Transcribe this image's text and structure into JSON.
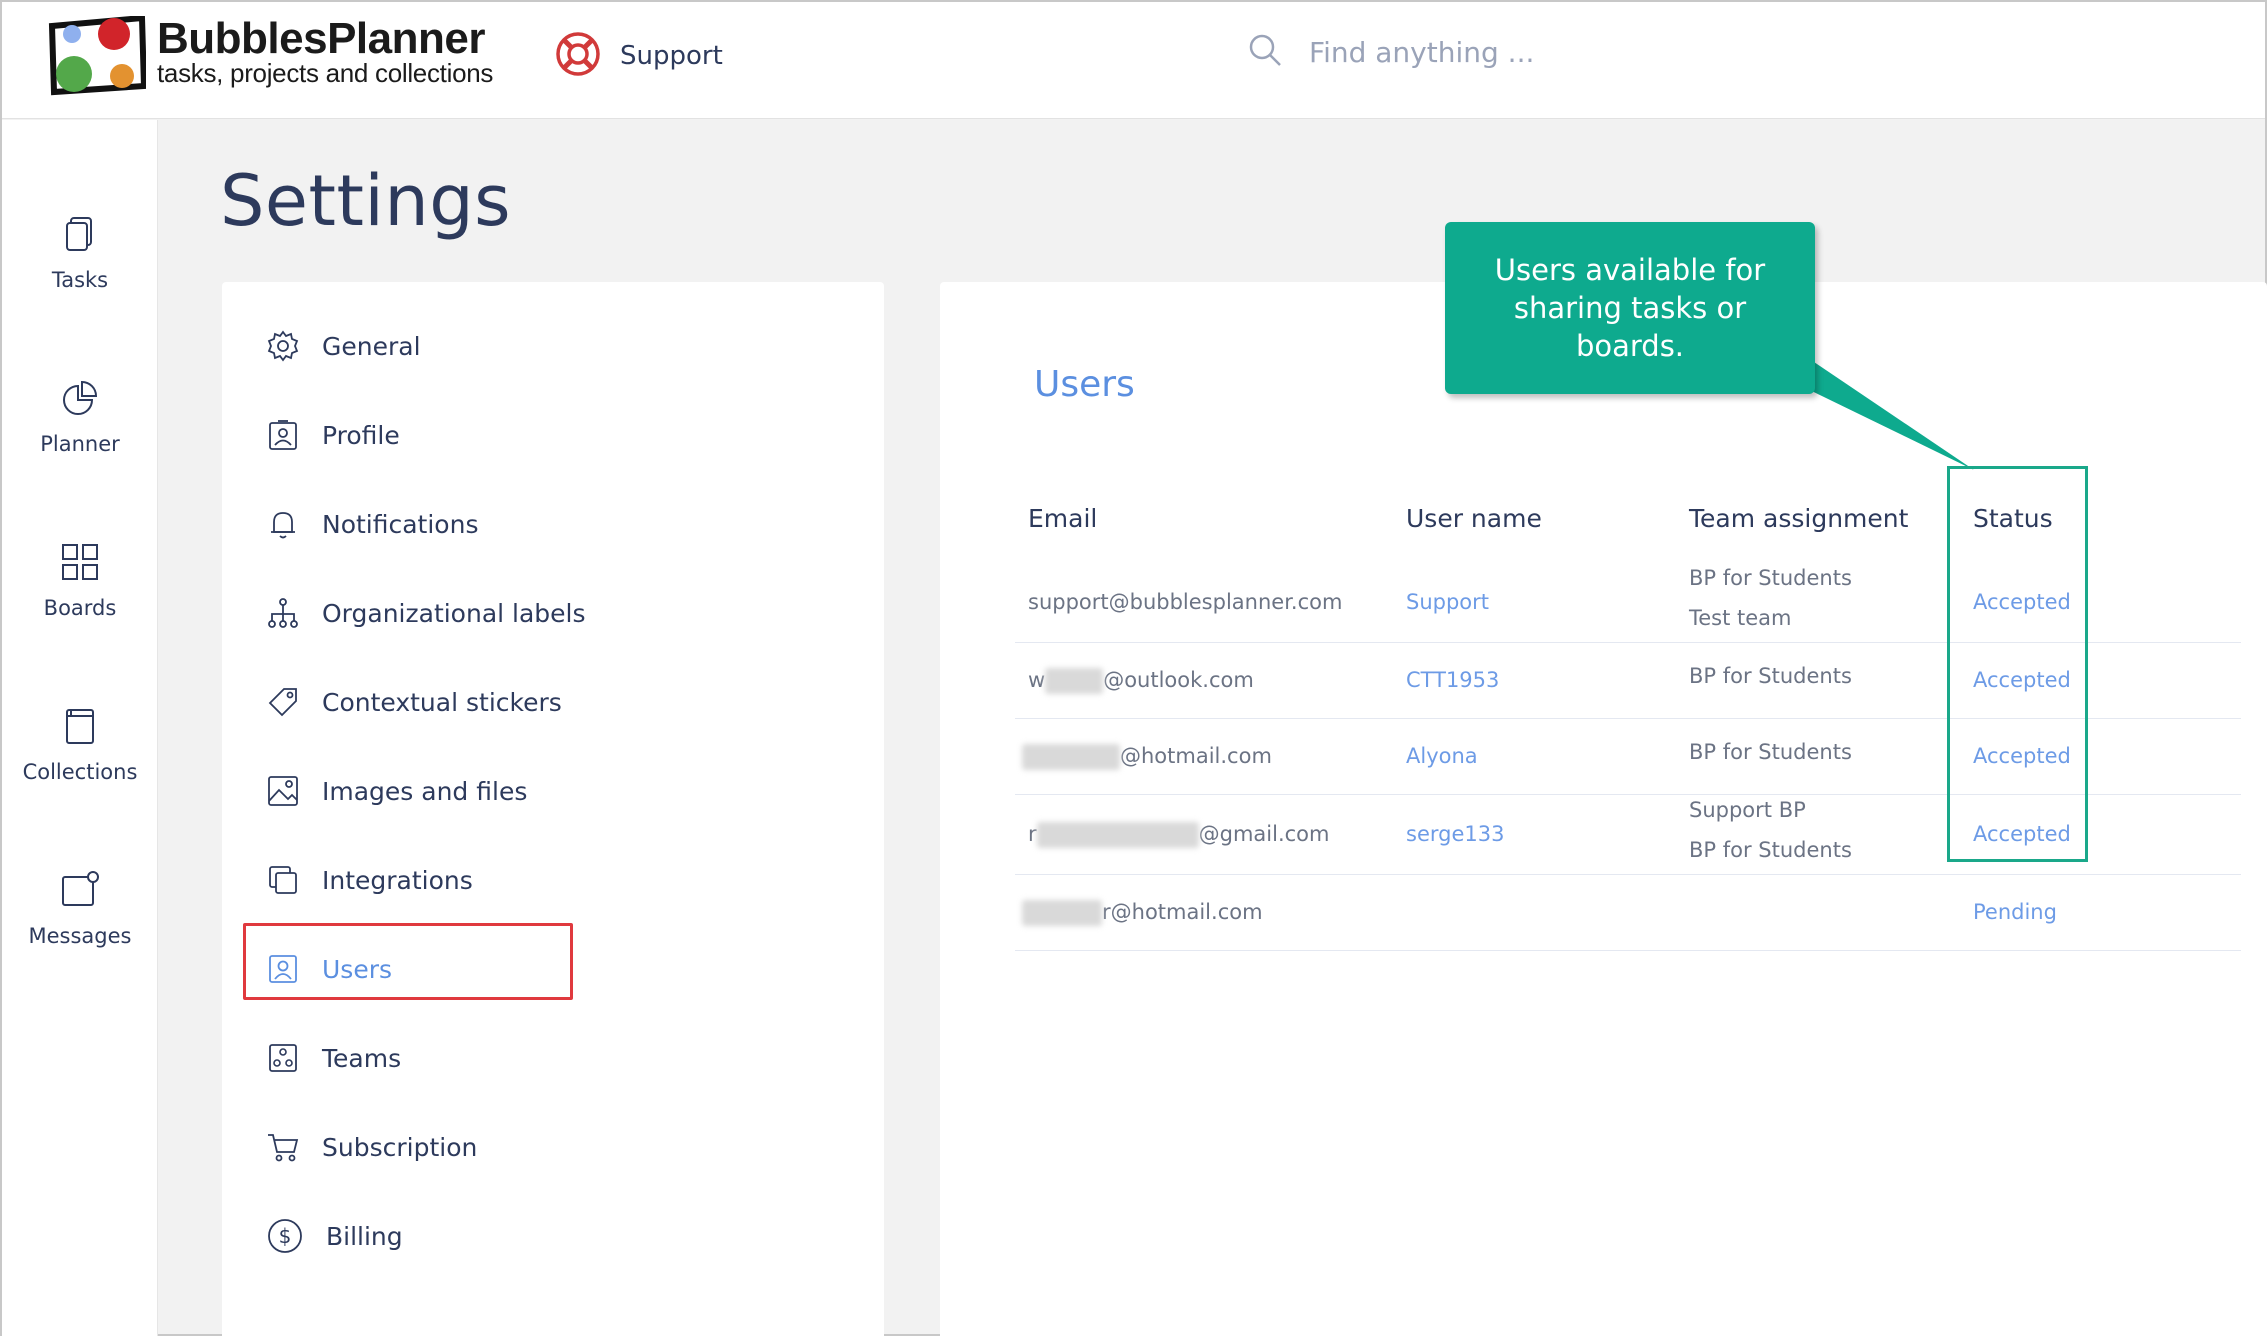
{
  "brand": {
    "name": "BubblesPlanner",
    "tagline": "tasks, projects and collections"
  },
  "header": {
    "support_label": "Support",
    "search_placeholder": "Find anything ..."
  },
  "leftnav": {
    "items": [
      {
        "label": "Tasks",
        "icon": "tasks-icon"
      },
      {
        "label": "Planner",
        "icon": "planner-icon"
      },
      {
        "label": "Boards",
        "icon": "boards-icon"
      },
      {
        "label": "Collections",
        "icon": "collections-icon"
      },
      {
        "label": "Messages",
        "icon": "messages-icon"
      }
    ]
  },
  "page": {
    "title": "Settings"
  },
  "settings_menu": {
    "items": [
      {
        "label": "General",
        "icon": "gear-icon"
      },
      {
        "label": "Profile",
        "icon": "profile-icon"
      },
      {
        "label": "Notifications",
        "icon": "bell-icon"
      },
      {
        "label": "Organizational labels",
        "icon": "hierarchy-icon"
      },
      {
        "label": "Contextual stickers",
        "icon": "tag-icon"
      },
      {
        "label": "Images and files",
        "icon": "image-icon"
      },
      {
        "label": "Integrations",
        "icon": "integrations-icon"
      },
      {
        "label": "Users",
        "icon": "user-icon",
        "active": true
      },
      {
        "label": "Teams",
        "icon": "teams-icon"
      },
      {
        "label": "Subscription",
        "icon": "cart-icon"
      },
      {
        "label": "Billing",
        "icon": "dollar-icon"
      }
    ]
  },
  "users": {
    "title": "Users",
    "columns": [
      "Email",
      "User name",
      "Team assignment",
      "Status"
    ],
    "rows": [
      {
        "email": "support@bubblesplanner.com",
        "username": "Support",
        "teams": [
          "BP for Students",
          "Test team"
        ],
        "status": "Accepted"
      },
      {
        "email_prefix": "w",
        "email": "@outlook.com",
        "username": "CTT1953",
        "teams": [
          "BP for Students"
        ],
        "status": "Accepted"
      },
      {
        "email": "@hotmail.com",
        "username": "Alyona",
        "teams": [
          "BP for Students"
        ],
        "status": "Accepted"
      },
      {
        "email_prefix": "r",
        "email": "@gmail.com",
        "username": "serge133",
        "teams": [
          "Support BP",
          "BP for Students"
        ],
        "status": "Accepted"
      },
      {
        "email": "r@hotmail.com",
        "username": "",
        "teams": [],
        "status": "Pending"
      }
    ]
  },
  "callout": {
    "text": "Users available for sharing tasks or boards."
  },
  "colors": {
    "accent": "#5b8fe0",
    "callout": "#0eaa8e",
    "highlight": "#e0393e",
    "navy": "#2d3a5c"
  }
}
